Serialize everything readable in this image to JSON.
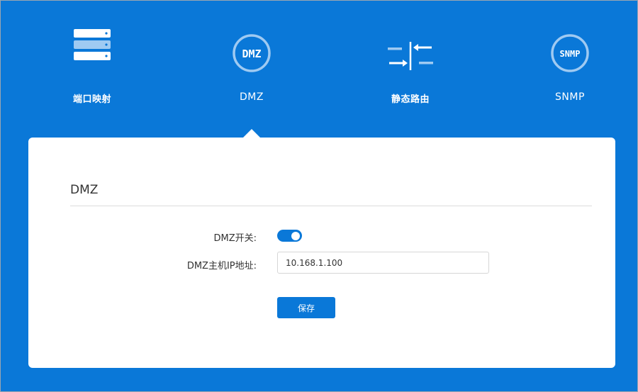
{
  "nav": {
    "items": [
      {
        "label": "端口映射",
        "icon": "server-icon"
      },
      {
        "label": "DMZ",
        "icon": "dmz-icon",
        "icon_text": "DMZ",
        "active": true
      },
      {
        "label": "静态路由",
        "icon": "static-route-icon"
      },
      {
        "label": "SNMP",
        "icon": "snmp-icon",
        "icon_text": "SNMP"
      }
    ]
  },
  "panel": {
    "title": "DMZ",
    "dmz_switch": {
      "label": "DMZ开关:",
      "enabled": true
    },
    "dmz_host_ip": {
      "label": "DMZ主机IP地址:",
      "value": "10.168.1.100"
    },
    "save_label": "保存"
  },
  "colors": {
    "background": "#0a78d8",
    "accent": "#0a78d8",
    "panel": "#ffffff",
    "icon_light": "#9fcaf2"
  }
}
